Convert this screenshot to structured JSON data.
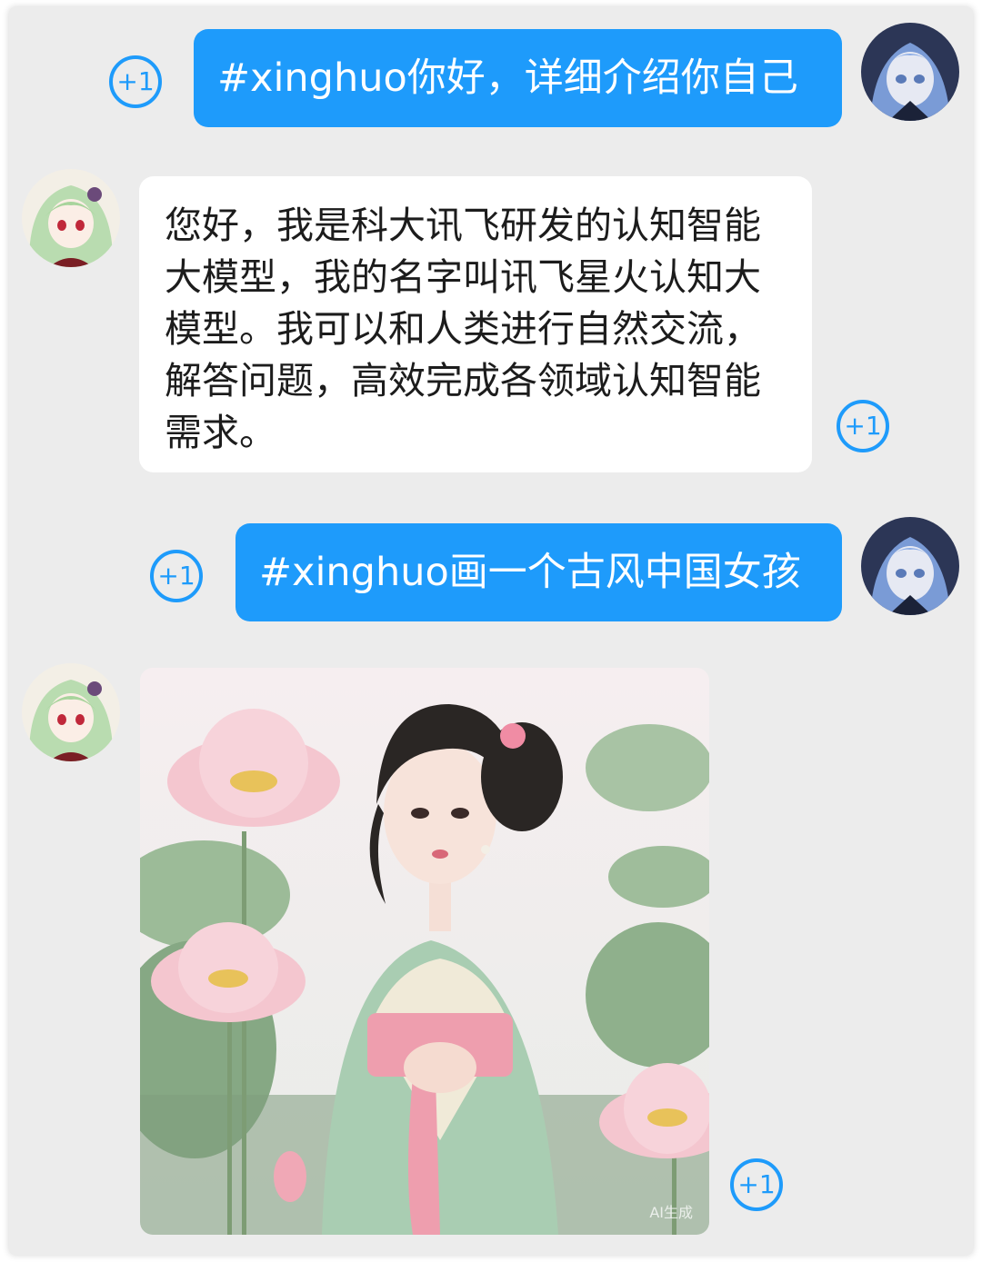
{
  "messages": [
    {
      "role": "user",
      "text": "#xinghuo你好，详细介绍你自己"
    },
    {
      "role": "bot",
      "text": "您好，我是科大讯飞研发的认知智能大模型，我的名字叫讯飞星火认知大模型。我可以和人类进行自然交流，解答问题，高效完成各领域认知智能需求。"
    },
    {
      "role": "user",
      "text": "#xinghuo画一个古风中国女孩"
    },
    {
      "role": "bot",
      "image": "ancient-style-chinese-girl-with-lotus",
      "watermark": "AI生成"
    }
  ],
  "plus_one_label": "+1",
  "colors": {
    "accent": "#1e9bfb",
    "background": "#ececec",
    "bubble_in": "#ffffff"
  }
}
